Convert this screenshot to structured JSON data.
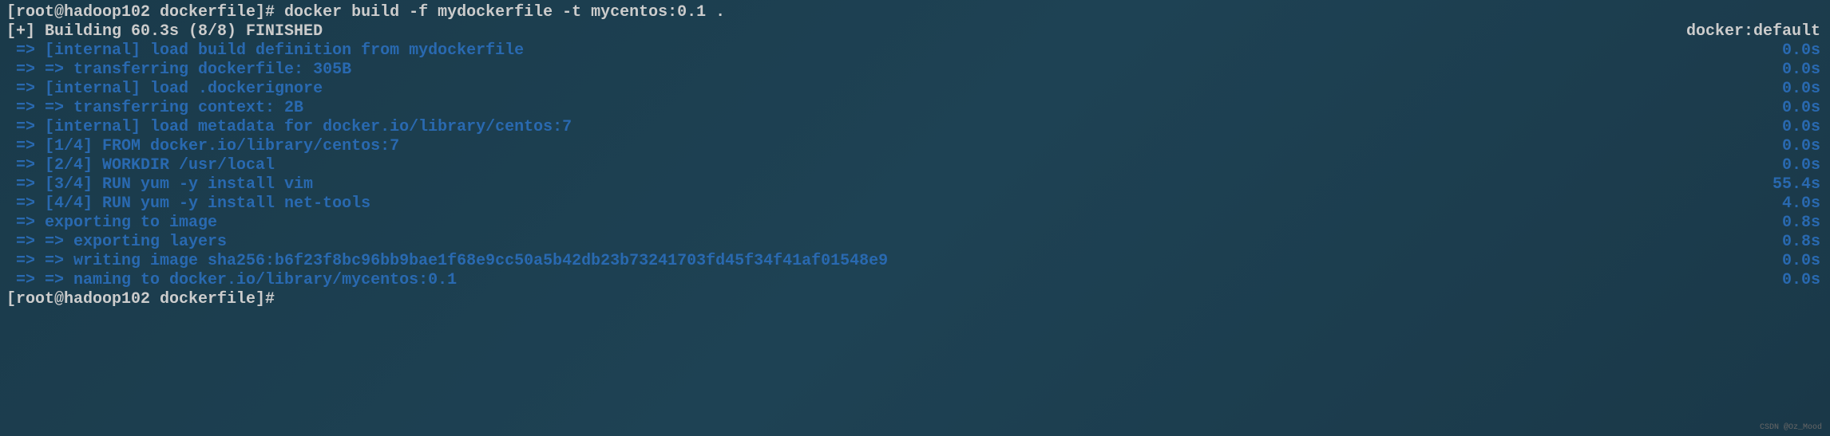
{
  "commands": {
    "line1": "[root@hadoop102 dockerfile]# docker build -f mydockerfile -t mycentos:0.1 .",
    "line_last": "[root@hadoop102 dockerfile]#"
  },
  "building": {
    "left": "[+] Building 60.3s (8/8) FINISHED",
    "right": "docker:default"
  },
  "steps": [
    {
      "text": " => [internal] load build definition from mydockerfile",
      "time": "0.0s"
    },
    {
      "text": " => => transferring dockerfile: 305B",
      "time": "0.0s"
    },
    {
      "text": " => [internal] load .dockerignore",
      "time": "0.0s"
    },
    {
      "text": " => => transferring context: 2B",
      "time": "0.0s"
    },
    {
      "text": " => [internal] load metadata for docker.io/library/centos:7",
      "time": "0.0s"
    },
    {
      "text": " => [1/4] FROM docker.io/library/centos:7",
      "time": "0.0s"
    },
    {
      "text": " => [2/4] WORKDIR /usr/local",
      "time": "0.0s"
    },
    {
      "text": " => [3/4] RUN yum -y install vim",
      "time": "55.4s"
    },
    {
      "text": " => [4/4] RUN yum -y install net-tools",
      "time": "4.0s"
    },
    {
      "text": " => exporting to image",
      "time": "0.8s"
    },
    {
      "text": " => => exporting layers",
      "time": "0.8s"
    },
    {
      "text": " => => writing image sha256:b6f23f8bc96bb9bae1f68e9cc50a5b42db23b73241703fd45f34f41af01548e9",
      "time": "0.0s"
    },
    {
      "text": " => => naming to docker.io/library/mycentos:0.1",
      "time": "0.0s"
    }
  ],
  "watermark": "CSDN @Oz_Mood"
}
